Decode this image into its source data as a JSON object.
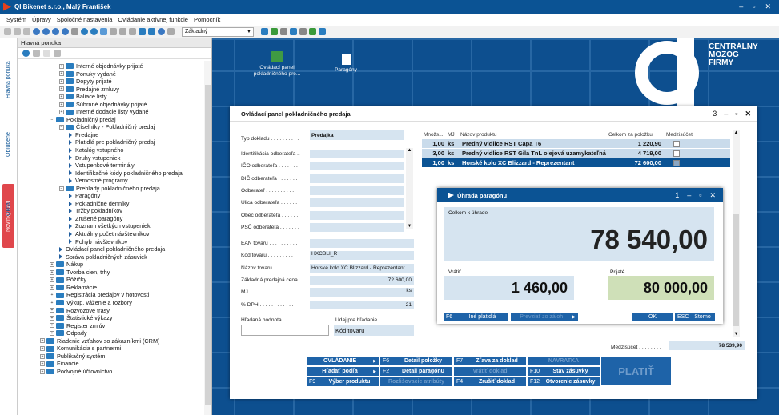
{
  "app": {
    "title": "QI Bikenet s.r.o., Malý František",
    "window_controls": [
      "–",
      "▫",
      "✕"
    ]
  },
  "menu": [
    "Systém",
    "Úpravy",
    "Spoločné nastavenia",
    "Ovládanie aktívnej funkcie",
    "Pomocník"
  ],
  "toolbar": {
    "profile_select": "Základný"
  },
  "sidetabs": {
    "main": "Hlavná ponuka",
    "favorites": "Obľúbené",
    "news": "Novinky (19)",
    "windows": "Okná"
  },
  "nav": {
    "header": "Hlavná ponuka",
    "items": [
      {
        "label": "Interné objednávky prijaté",
        "lvl": 1,
        "kind": "folder",
        "exp": "+"
      },
      {
        "label": "Ponuky vydané",
        "lvl": 1,
        "kind": "folder",
        "exp": "+"
      },
      {
        "label": "Dopyty prijaté",
        "lvl": 1,
        "kind": "folder",
        "exp": "+"
      },
      {
        "label": "Predajné zmluvy",
        "lvl": 1,
        "kind": "folder",
        "exp": "+"
      },
      {
        "label": "Baliace listy",
        "lvl": 1,
        "kind": "folder",
        "exp": "+"
      },
      {
        "label": "Súhrnné objednávky prijaté",
        "lvl": 1,
        "kind": "folder",
        "exp": "+"
      },
      {
        "label": "Interné dodacie listy vydané",
        "lvl": 1,
        "kind": "folder",
        "exp": "+"
      },
      {
        "label": "Pokladničný predaj",
        "lvl": 0,
        "kind": "folder",
        "exp": "-"
      },
      {
        "label": "Číselníky - Pokladničný predaj",
        "lvl": 1,
        "kind": "folder",
        "exp": "-"
      },
      {
        "label": "Predajne",
        "lvl": 2,
        "kind": "item"
      },
      {
        "label": "Platidlá pre pokladničný predaj",
        "lvl": 2,
        "kind": "item"
      },
      {
        "label": "Katalóg vstupného",
        "lvl": 2,
        "kind": "item"
      },
      {
        "label": "Druhy vstupeniek",
        "lvl": 2,
        "kind": "item"
      },
      {
        "label": "Vstupenkové terminály",
        "lvl": 2,
        "kind": "item"
      },
      {
        "label": "Identifikačné kódy pokladničného predaja",
        "lvl": 2,
        "kind": "item"
      },
      {
        "label": "Vernostné programy",
        "lvl": 2,
        "kind": "item"
      },
      {
        "label": "Prehľady pokladničného predaja",
        "lvl": 1,
        "kind": "folder",
        "exp": "-"
      },
      {
        "label": "Paragóny",
        "lvl": 2,
        "kind": "item"
      },
      {
        "label": "Pokladničné denníky",
        "lvl": 2,
        "kind": "item"
      },
      {
        "label": "Tržby pokladníkov",
        "lvl": 2,
        "kind": "item"
      },
      {
        "label": "Zrušené paragóny",
        "lvl": 2,
        "kind": "item"
      },
      {
        "label": "Zoznam všetkých vstupeniek",
        "lvl": 2,
        "kind": "item"
      },
      {
        "label": "Aktuálny počet návštevníkov",
        "lvl": 2,
        "kind": "item"
      },
      {
        "label": "Pohyb návštevníkov",
        "lvl": 2,
        "kind": "item"
      },
      {
        "label": "Ovládací panel pokladničného predaja",
        "lvl": 1,
        "kind": "item"
      },
      {
        "label": "Správa pokladničných zásuviek",
        "lvl": 1,
        "kind": "item"
      },
      {
        "label": "Nákup",
        "lvl": 0,
        "kind": "folder",
        "exp": "+"
      },
      {
        "label": "Tvorba cien, trhy",
        "lvl": 0,
        "kind": "folder",
        "exp": "+"
      },
      {
        "label": "Pôžičky",
        "lvl": 0,
        "kind": "folder",
        "exp": "+"
      },
      {
        "label": "Reklamácie",
        "lvl": 0,
        "kind": "folder",
        "exp": "+"
      },
      {
        "label": "Registrácia predajov v hotovosti",
        "lvl": 0,
        "kind": "folder",
        "exp": "+"
      },
      {
        "label": "Výkup, váženie a rozbory",
        "lvl": 0,
        "kind": "folder",
        "exp": "+"
      },
      {
        "label": "Rozvozové trasy",
        "lvl": 0,
        "kind": "folder",
        "exp": "+"
      },
      {
        "label": "Štatistické výkazy",
        "lvl": 0,
        "kind": "folder",
        "exp": "+"
      },
      {
        "label": "Register zmlúv",
        "lvl": 0,
        "kind": "folder",
        "exp": "+"
      },
      {
        "label": "Odpady",
        "lvl": 0,
        "kind": "folder",
        "exp": "+"
      },
      {
        "label": "Riadenie vzťahov so zákazníkmi (CRM)",
        "lvl": -1,
        "kind": "folder",
        "exp": "+"
      },
      {
        "label": "Komunikácia s partnermi",
        "lvl": -1,
        "kind": "folder",
        "exp": "+"
      },
      {
        "label": "Publikačný systém",
        "lvl": -1,
        "kind": "folder",
        "exp": "+"
      },
      {
        "label": "Financie",
        "lvl": -1,
        "kind": "folder",
        "exp": "+"
      },
      {
        "label": "Podvojné účtovníctvo",
        "lvl": -1,
        "kind": "folder",
        "exp": "+"
      }
    ]
  },
  "desktop": {
    "icons": [
      {
        "label": "Ovládací panel pokladničného pre..."
      },
      {
        "label": "Paragóny"
      }
    ],
    "brand": [
      "CENTRÁLNY",
      "MOZOG",
      "FIRMY"
    ]
  },
  "main": {
    "title": "Ovládací panel pokladničného predaja",
    "title_no": "3",
    "form": {
      "typ_label": "Typ dokladu . . . . . . . . . .",
      "typ_value": "Predajka",
      "fields": [
        {
          "label": "Identifikácia odberateľa ..",
          "value": ""
        },
        {
          "label": "IČO odberateľa . . . . . . .",
          "value": ""
        },
        {
          "label": "DIČ odberateľa . . . . . . .",
          "value": ""
        },
        {
          "label": "Odberateľ . . . . . . . . . .",
          "value": ""
        },
        {
          "label": "Ulica odberateľa . . . . . .",
          "value": ""
        },
        {
          "label": "Obec odberateľa . . . . . .",
          "value": ""
        },
        {
          "label": "PSČ odberateľa . . . . . . .",
          "value": ""
        }
      ],
      "product": [
        {
          "label": "EAN tovaru . . . . . . . . . .",
          "value": ""
        },
        {
          "label": "Kód tovaru . . . . . . . . .",
          "value": "HXCBLI_R"
        },
        {
          "label": "Názov tovaru . . . . . . .",
          "value": "Horské kolo XC Blizzard - Reprezentant"
        },
        {
          "label": "Základná predajná cena . .",
          "value": "72 600,00"
        },
        {
          "label": "MJ . . . . . . . . . . . . . . .",
          "value": "ks"
        },
        {
          "label": "% DPH . . . . . . . . . . . .",
          "value": "21"
        }
      ],
      "search_label": "Hľadaná hodnota",
      "search_value": "",
      "field_label": "Údaj pre hľadanie",
      "field_value": "Kód tovaru"
    },
    "table": {
      "headers": [
        "Množs...",
        "MJ",
        "Názov produktu",
        "Celkom za položku",
        "Medzisúčet"
      ],
      "rows": [
        {
          "qty": "1,00",
          "mj": "ks",
          "name": "Predný vidlice RST Capa T6",
          "total": "1 220,90"
        },
        {
          "qty": "3,00",
          "mj": "ks",
          "name": "Predný vidlice RST Gila TnL olejová uzamykateľná",
          "total": "4 719,00"
        },
        {
          "qty": "1,00",
          "mj": "ks",
          "name": "Horské kolo XC Blizzard - Reprezentant",
          "total": "72 600,00"
        }
      ]
    },
    "subtotal_label": "Medzisúčet . . . . . . . .",
    "subtotal_value": "78 539,90",
    "buttons": [
      {
        "k": "",
        "l": "OVLÁDANIE",
        "arrow": true
      },
      {
        "k": "F6",
        "l": "Detail položky"
      },
      {
        "k": "F7",
        "l": "Zľava za doklad"
      },
      {
        "k": "",
        "l": "NAVRATKA",
        "dis": true
      },
      {
        "k": "",
        "l": "Hľadať podľa",
        "arrow": true
      },
      {
        "k": "F2",
        "l": "Detail paragónu"
      },
      {
        "k": "",
        "l": "Vrátiť doklad",
        "dis": true
      },
      {
        "k": "F10",
        "l": "Stav zásuvky"
      },
      {
        "k": "F9",
        "l": "Výber produktu"
      },
      {
        "k": "",
        "l": "Rozlišovacie atribúty",
        "dis": true
      },
      {
        "k": "F4",
        "l": "Zrušiť doklad"
      },
      {
        "k": "F12",
        "l": "Otvorenie zásuvky"
      }
    ],
    "platit": "PLATIŤ"
  },
  "pay": {
    "title": "Úhrada paragónu",
    "title_no": "1",
    "total_label": "Celkom k úhrade",
    "total": "78 540,00",
    "return_label": "Vrátiť",
    "return": "1 460,00",
    "received_label": "Prijaté",
    "received": "80 000,00",
    "btn_other_k": "F6",
    "btn_other": "Iné platidlá",
    "btn_card": "Prevziať zo záloh",
    "btn_ok": "OK",
    "btn_cancel_k": "ESC",
    "btn_cancel": "Storno"
  },
  "colors": {
    "accent": "#0b5394",
    "field": "#d6e4f0",
    "received_bg": "#cfe0b8"
  }
}
